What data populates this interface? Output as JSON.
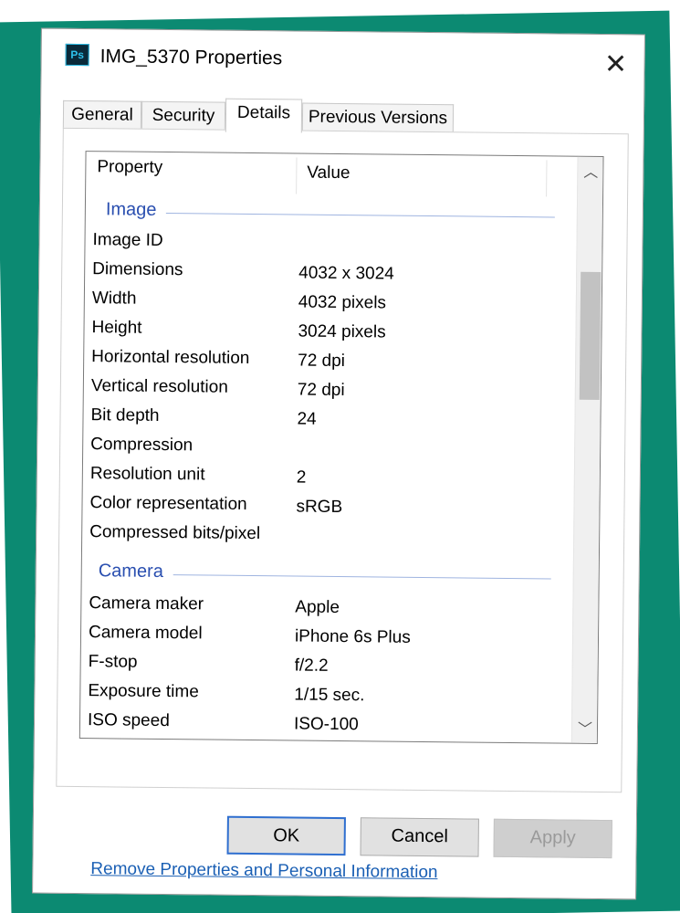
{
  "window": {
    "title": "IMG_5370 Properties",
    "app_icon_label": "Ps"
  },
  "tabs": [
    {
      "label": "General",
      "active": false
    },
    {
      "label": "Security",
      "active": false
    },
    {
      "label": "Details",
      "active": true
    },
    {
      "label": "Previous Versions",
      "active": false
    }
  ],
  "list": {
    "columns": [
      "Property",
      "Value"
    ],
    "groups": [
      {
        "name": "Image",
        "rows": [
          {
            "property": "Image ID",
            "value": ""
          },
          {
            "property": "Dimensions",
            "value": "4032 x 3024"
          },
          {
            "property": "Width",
            "value": "4032 pixels"
          },
          {
            "property": "Height",
            "value": "3024 pixels"
          },
          {
            "property": "Horizontal resolution",
            "value": "72 dpi"
          },
          {
            "property": "Vertical resolution",
            "value": "72 dpi"
          },
          {
            "property": "Bit depth",
            "value": "24"
          },
          {
            "property": "Compression",
            "value": ""
          },
          {
            "property": "Resolution unit",
            "value": "2"
          },
          {
            "property": "Color representation",
            "value": "sRGB"
          },
          {
            "property": "Compressed bits/pixel",
            "value": ""
          }
        ]
      },
      {
        "name": "Camera",
        "rows": [
          {
            "property": "Camera maker",
            "value": "Apple"
          },
          {
            "property": "Camera model",
            "value": "iPhone 6s Plus"
          },
          {
            "property": "F-stop",
            "value": "f/2.2"
          },
          {
            "property": "Exposure time",
            "value": "1/15 sec."
          },
          {
            "property": "ISO speed",
            "value": "ISO-100"
          }
        ]
      }
    ]
  },
  "link_text": "Remove Properties and Personal Information",
  "buttons": {
    "ok": "OK",
    "cancel": "Cancel",
    "apply": "Apply"
  },
  "colors": {
    "frame_accent": "#0c8a72",
    "group_header": "#2a4fb0",
    "link": "#1a5fb4",
    "default_button_border": "#2f6fd0"
  }
}
